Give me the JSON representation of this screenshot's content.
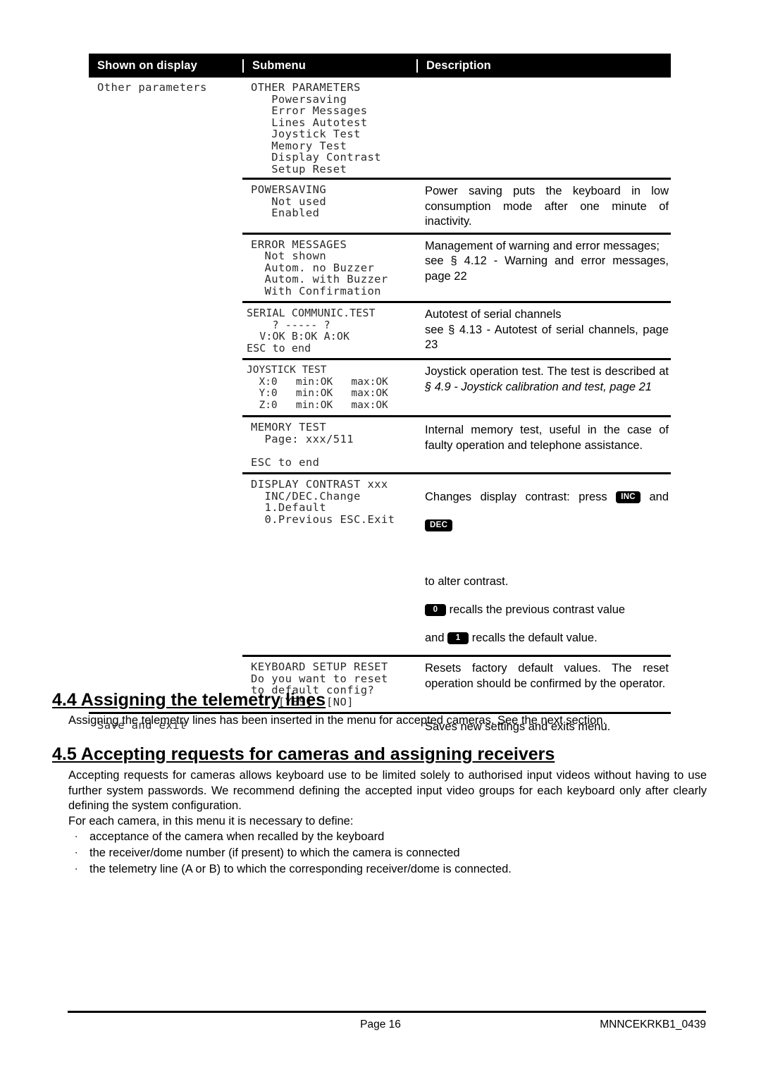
{
  "table": {
    "headers": [
      "Shown on display",
      "Submenu",
      "Description"
    ],
    "rows": [
      {
        "display": "Other parameters",
        "submenu": "OTHER PARAMETERS\n   Powersaving\n   Error Messages\n   Lines Autotest\n   Joystick Test\n   Memory Test\n   Display Contrast\n   Setup Reset",
        "description": ""
      },
      {
        "display": "",
        "submenu": "POWERSAVING\n   Not used\n   Enabled",
        "description": "Power saving puts the keyboard in low consumption mode after one minute of inactivity."
      },
      {
        "display": "",
        "submenu": "ERROR MESSAGES\n  Not shown\n  Autom. no Buzzer\n  Autom. with Buzzer\n  With Confirmation",
        "description": "Management of warning and error messages;",
        "description_italic": "see § 4.12 - Warning and error messages, page 22"
      },
      {
        "display": "",
        "submenu": "SERIAL COMMUNIC.TEST\n    ? ----- ?\n  V:OK B:OK A:OK\nESC to end",
        "description": "Autotest of serial channels",
        "description_italic": "see § 4.13 - Autotest of serial channels, page 23"
      },
      {
        "display": "",
        "submenu": "JOYSTICK TEST\n  X:0   min:OK   max:OK\n  Y:0   min:OK   max:OK\n  Z:0   min:OK   max:OK",
        "description": "Joystick operation test. The test is described at ",
        "description_italic": "§ 4.9 - Joystick calibration and test, page 21"
      },
      {
        "display": "",
        "submenu": "MEMORY TEST\n  Page: xxx/511\n\nESC to end",
        "description": "Internal memory test, useful in the case of faulty operation and telephone assistance."
      },
      {
        "display": "",
        "submenu": "DISPLAY CONTRAST xxx\n  INC/DEC.Change\n  1.Default\n  0.Previous ESC.Exit",
        "description_parts": {
          "p1": "Changes display contrast: press",
          "key_inc": "INC",
          "p2": "and",
          "key_dec": "DEC",
          "p3": "to alter contrast.",
          "key_0": "0",
          "p4": "recalls the previous contrast value",
          "p5": "and",
          "key_1": "1",
          "p6": "recalls the default value."
        }
      },
      {
        "display": "",
        "submenu": "KEYBOARD SETUP RESET\nDo you want to reset\nto default config?\n    [YES]  [NO]",
        "description": "Resets factory default values. The reset operation should be confirmed by the operator."
      },
      {
        "display": "Save and exit",
        "submenu": "",
        "description": "Saves new settings and exits menu."
      }
    ]
  },
  "sections": {
    "s44": {
      "heading": "4.4 Assigning  the telemetry lines",
      "paragraph": "Assigning the telemetry lines has been inserted in the menu for accepted cameras. See the next section."
    },
    "s45": {
      "heading": "4.5 Accepting  requests for cameras and assigning receivers",
      "paragraph": "Accepting requests for cameras allows keyboard use to be limited solely to authorised input videos without having to use further system passwords. We recommend defining the accepted input video groups for each keyboard only after clearly defining the system configuration.",
      "paragraph2": "For each camera, in this menu it is necessary to define:",
      "bullets": [
        "acceptance of the camera when recalled by the keyboard",
        "the receiver/dome number (if present) to which the camera is connected",
        "the telemetry line (A or B) to which the corresponding receiver/dome is connected."
      ],
      "bullet_glyph": "∙"
    }
  },
  "footer": {
    "page": "Page 16",
    "doc_code": "MNNCEKRKB1_0439"
  },
  "colors": {
    "header_bg": "#000000",
    "header_text": "#ffffff",
    "body_text": "#000000",
    "lcd_text": "#2a2a2a",
    "key_bg": "#000000"
  }
}
